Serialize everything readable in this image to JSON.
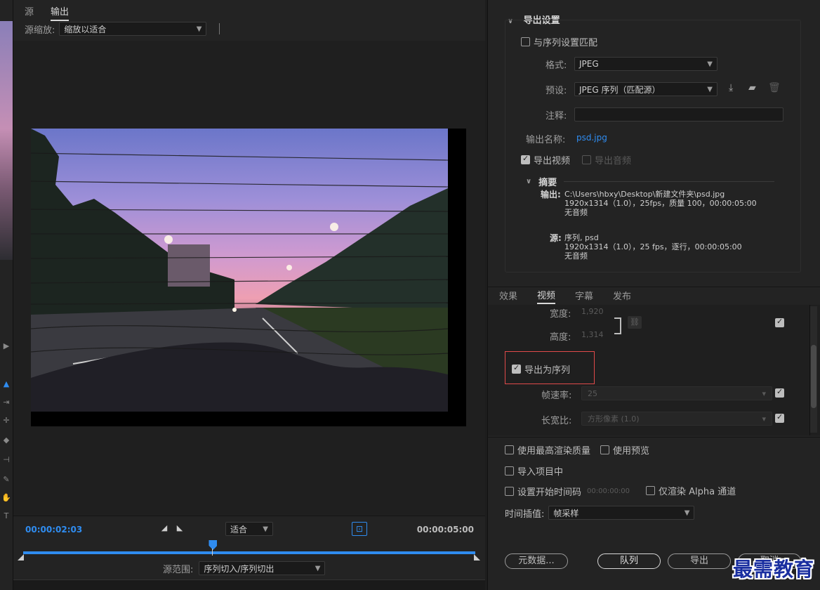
{
  "left": {
    "tabs": [
      {
        "label": "源"
      },
      {
        "label": "输出"
      }
    ],
    "scale_label": "源缩放:",
    "scale_value": "缩放以适合",
    "timecode_current": "00:00:02:03",
    "timecode_total": "00:00:05:00",
    "fit_value": "适合",
    "range_label": "源范围:",
    "range_value": "序列切入/序列切出",
    "playhead_fraction": 0.42
  },
  "export": {
    "section_title": "导出设置",
    "match_sequence_label": "与序列设置匹配",
    "format_label": "格式:",
    "format_value": "JPEG",
    "preset_label": "预设:",
    "preset_value": "JPEG 序列（匹配源）",
    "comment_label": "注释:",
    "output_name_label": "输出名称:",
    "output_name_value": "psd.jpg",
    "export_video_label": "导出视频",
    "export_audio_label": "导出音频",
    "summary_title": "摘要",
    "summary": {
      "output_key": "输出:",
      "output_lines": [
        "C:\\Users\\hbxy\\Desktop\\新建文件夹\\psd.jpg",
        "1920x1314（1.0），25fps，质量 100，00:00:05:00",
        "无音频"
      ],
      "source_key": "源:",
      "source_lines": [
        "序列, psd",
        "1920x1314（1.0），25 fps，逐行，00:00:05:00",
        "无音频"
      ]
    }
  },
  "video_tabs": [
    {
      "label": "效果"
    },
    {
      "label": "视频"
    },
    {
      "label": "字幕"
    },
    {
      "label": "发布"
    }
  ],
  "video": {
    "width_label": "宽度:",
    "width_value": "1,920",
    "height_label": "高度:",
    "height_value": "1,314",
    "export_as_sequence_label": "导出为序列",
    "framerate_label": "帧速率:",
    "framerate_value": "25",
    "aspect_label": "长宽比:",
    "aspect_value": "方形像素 (1.0)"
  },
  "options": {
    "max_quality_label": "使用最高渲染质量",
    "use_preview_label": "使用预览",
    "import_project_label": "导入项目中",
    "set_start_tc_label": "设置开始时间码",
    "start_tc_value": "00:00:00:00",
    "render_alpha_label": "仅渲染 Alpha 通道",
    "interp_label": "时间插值:",
    "interp_value": "帧采样"
  },
  "buttons": {
    "metadata": "元数据...",
    "queue": "队列",
    "export": "导出",
    "cancel": "取消"
  },
  "watermark": "最需教育",
  "colors": {
    "accent": "#2f8cf0",
    "highlight": "#e04a4a",
    "watermark": "#1a2fa0"
  }
}
